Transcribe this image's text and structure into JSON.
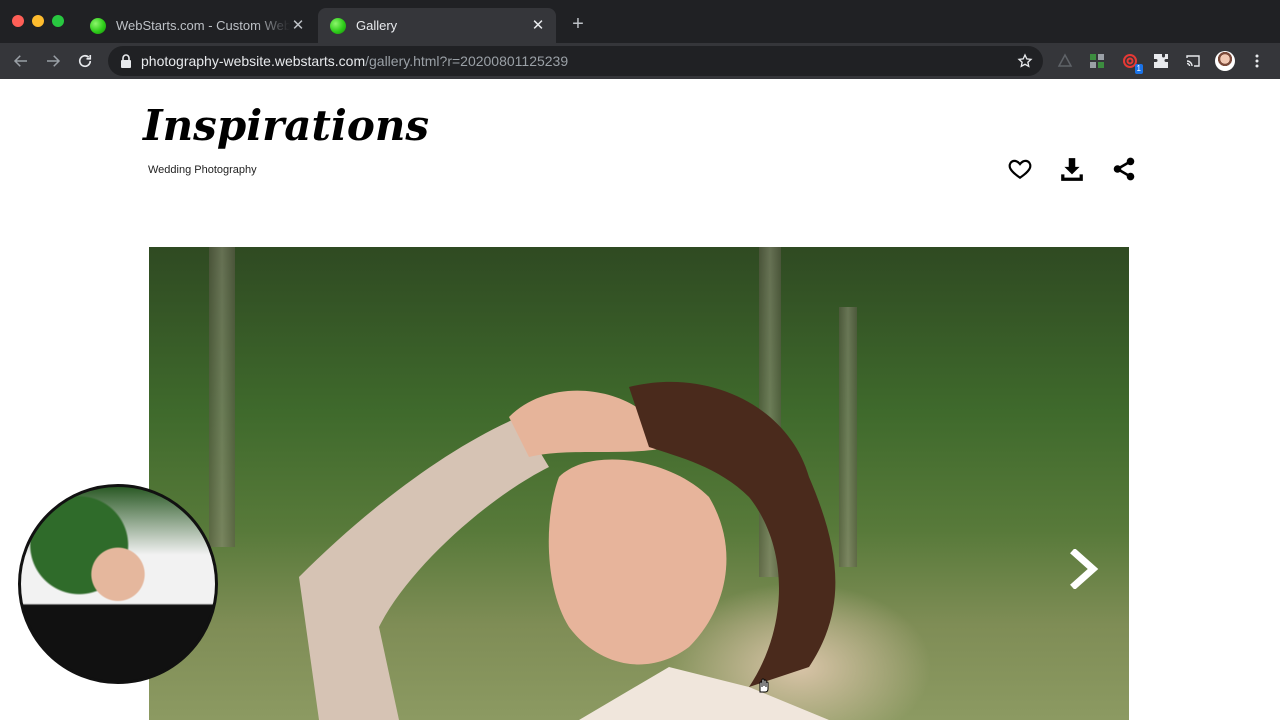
{
  "browser": {
    "tabs": [
      {
        "title": "WebStarts.com - Custom Web",
        "active": false
      },
      {
        "title": "Gallery",
        "active": true
      }
    ],
    "new_tab": "+",
    "close_glyph": "✕",
    "url_host": "photography-website.webstarts.com",
    "url_path": "/gallery.html?r=20200801125239",
    "extension_badge": "1",
    "colors": {
      "tabbar": "#202124",
      "toolbar": "#35363a",
      "favicon": "#2ecc1a"
    }
  },
  "site": {
    "logo": "Inspirations",
    "subtitle": "Wedding Photography",
    "actions": [
      {
        "icon": "heart-icon"
      },
      {
        "icon": "download-icon"
      },
      {
        "icon": "share-icon"
      }
    ]
  },
  "gallery": {
    "next_icon": "chevron-right-icon"
  }
}
